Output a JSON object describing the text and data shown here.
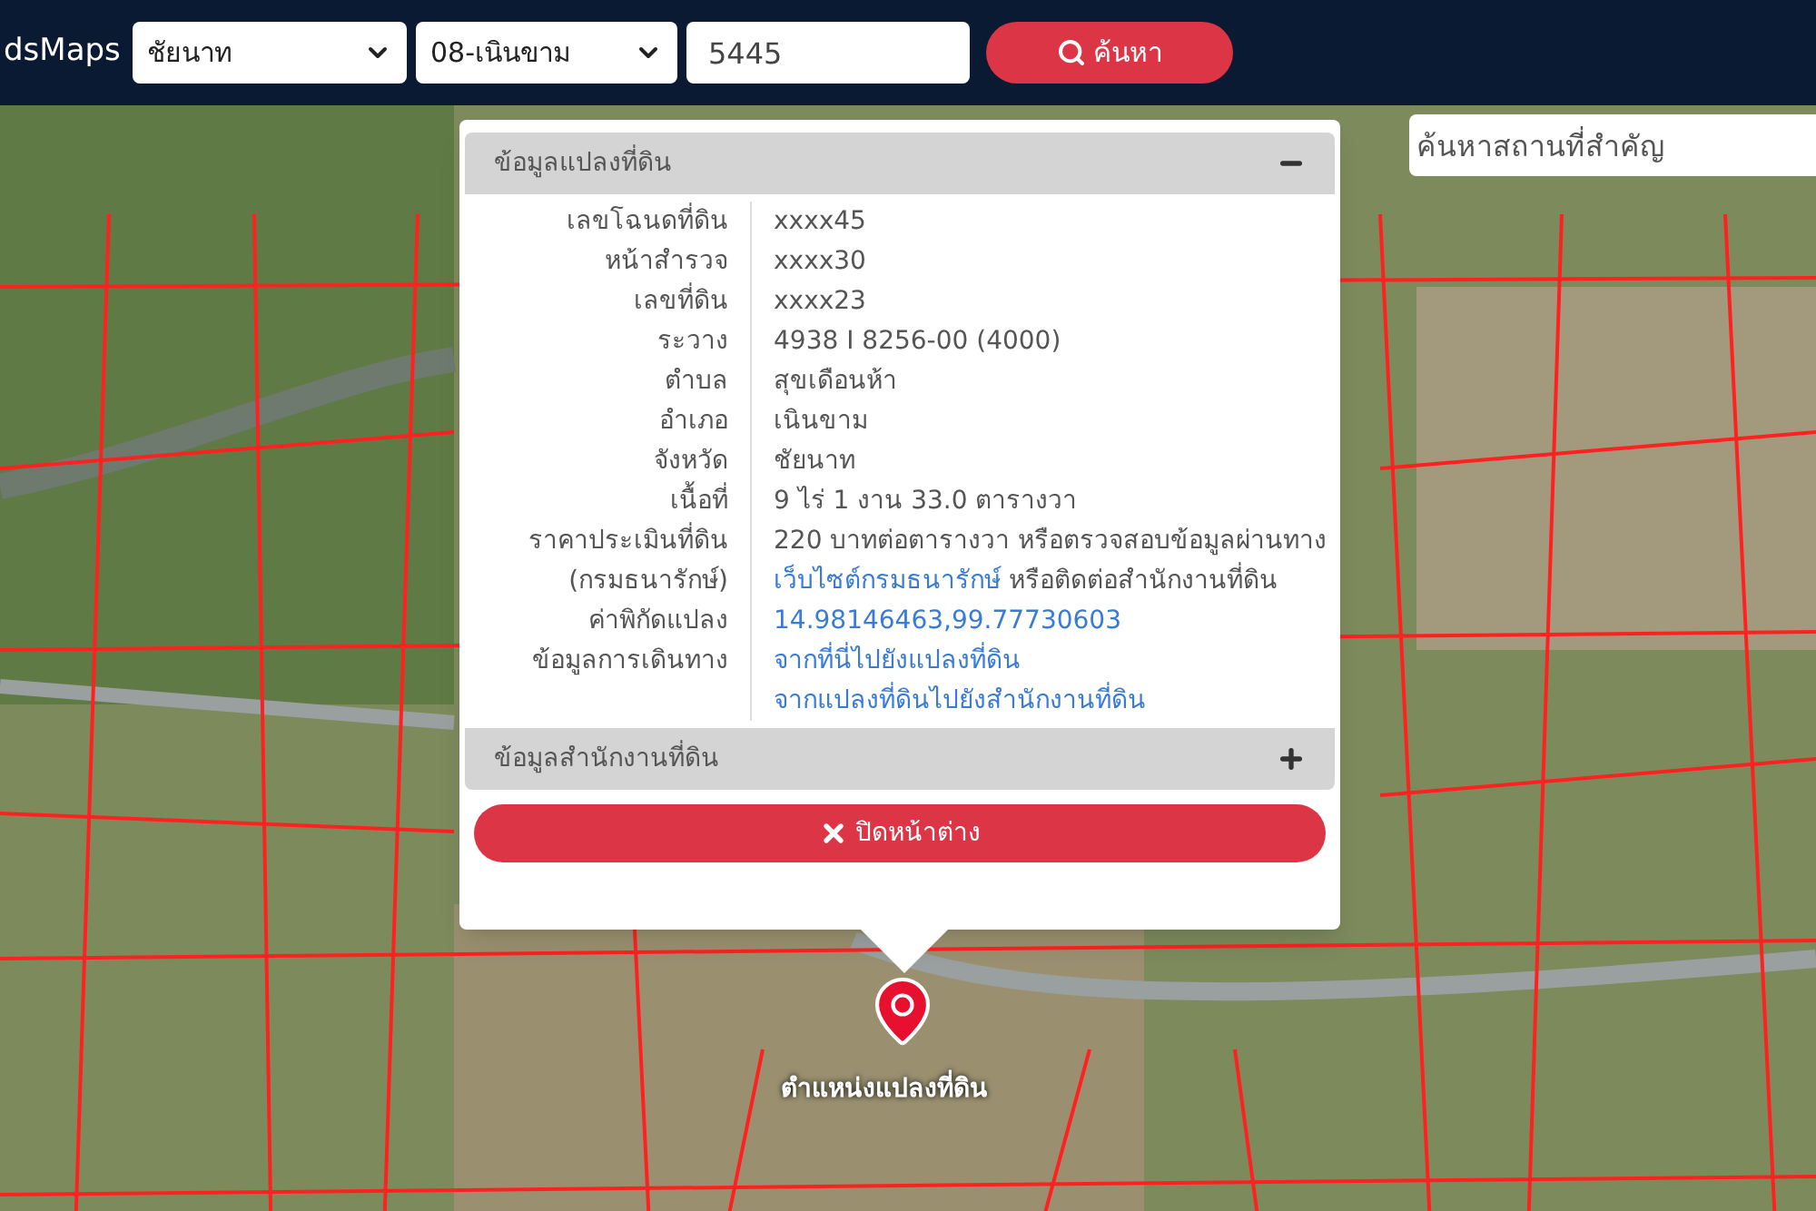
{
  "header": {
    "logo": "dsMaps",
    "province_select": "ชัยนาท",
    "district_select": "08-เนินขาม",
    "parcel_input": "5445",
    "search_button": "ค้นหา"
  },
  "place_search": {
    "placeholder": "ค้นหาสถานที่สำคัญ"
  },
  "popup": {
    "sections": [
      {
        "title": "ข้อมูลแปลงที่ดิน",
        "expanded": true,
        "rows": [
          {
            "label": "เลขโฉนดที่ดิน",
            "parts": [
              {
                "text": "xxxx45",
                "link": false
              }
            ]
          },
          {
            "label": "หน้าสำรวจ",
            "parts": [
              {
                "text": "xxxx30",
                "link": false
              }
            ]
          },
          {
            "label": "เลขที่ดิน",
            "parts": [
              {
                "text": "xxxx23",
                "link": false
              }
            ]
          },
          {
            "label": "ระวาง",
            "parts": [
              {
                "text": "4938 I 8256-00 (4000)",
                "link": false
              }
            ]
          },
          {
            "label": "ตำบล",
            "parts": [
              {
                "text": "สุขเดือนห้า",
                "link": false
              }
            ]
          },
          {
            "label": "อำเภอ",
            "parts": [
              {
                "text": "เนินขาม",
                "link": false
              }
            ]
          },
          {
            "label": "จังหวัด",
            "parts": [
              {
                "text": "ชัยนาท",
                "link": false
              }
            ]
          },
          {
            "label": "เนื้อที่",
            "parts": [
              {
                "text": "9 ไร่ 1 งาน 33.0 ตารางวา",
                "link": false
              }
            ]
          },
          {
            "label": "ราคาประเมินที่ดิน",
            "parts": [
              {
                "text": "220 บาทต่อตารางวา หรือตรวจสอบข้อมูลผ่านทาง",
                "link": false
              }
            ]
          },
          {
            "label": "(กรมธนารักษ์)",
            "parts": [
              {
                "text": "เว็บไซต์กรมธนารักษ์",
                "link": true
              },
              {
                "text": " หรือติดต่อสำนักงานที่ดิน",
                "link": false
              }
            ]
          },
          {
            "label": "ค่าพิกัดแปลง",
            "parts": [
              {
                "text": "14.98146463,99.77730603",
                "link": true
              }
            ]
          },
          {
            "label": "ข้อมูลการเดินทาง",
            "parts": [
              {
                "text": "จากที่นี่ไปยังแปลงที่ดิน",
                "link": true
              }
            ]
          },
          {
            "parts": [
              {
                "text": "จากแปลงที่ดินไปยังสำนักงานที่ดิน",
                "link": true
              }
            ]
          }
        ]
      },
      {
        "title": "ข้อมูลสำนักงานที่ดิน",
        "expanded": false
      }
    ],
    "close_button": "ปิดหน้าต่าง"
  },
  "marker": {
    "label": "ตำแหน่งแปลงที่ดิน"
  }
}
